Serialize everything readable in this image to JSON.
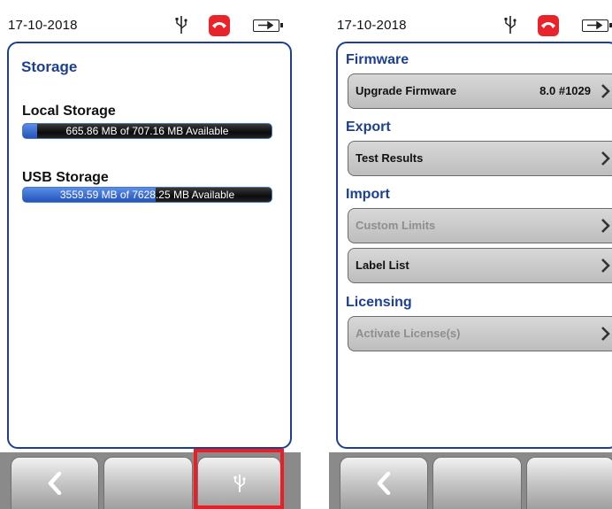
{
  "left_screen": {
    "status": {
      "date": "17-10-2018"
    },
    "title": "Storage",
    "local": {
      "label": "Local Storage",
      "text": "665.86 MB of 707.16 MB Available",
      "used_fraction": 0.058
    },
    "usb": {
      "label": "USB Storage",
      "text": "3559.59 MB of 7628.25 MB Available",
      "used_fraction": 0.533
    },
    "nav": {
      "back_icon": "chevron-left-icon",
      "usb_icon": "usb-icon",
      "highlight_color": "#ee1c24"
    }
  },
  "right_screen": {
    "status": {
      "date": "17-10-2018"
    },
    "sections": {
      "firmware": "Firmware",
      "export": "Export",
      "import": "Import",
      "licensing": "Licensing"
    },
    "buttons": {
      "upgrade_firmware": {
        "label": "Upgrade Firmware",
        "value": "8.0  #1029"
      },
      "test_results": {
        "label": "Test Results"
      },
      "custom_limits": {
        "label": "Custom Limits",
        "enabled": false
      },
      "label_list": {
        "label": "Label List"
      },
      "activate_license": {
        "label": "Activate License(s)",
        "enabled": false
      }
    },
    "nav": {
      "back_icon": "chevron-left-icon"
    }
  },
  "colors": {
    "accent": "#1d3f93",
    "phone": "#e8232a",
    "bar_fill": "#2454b8"
  }
}
